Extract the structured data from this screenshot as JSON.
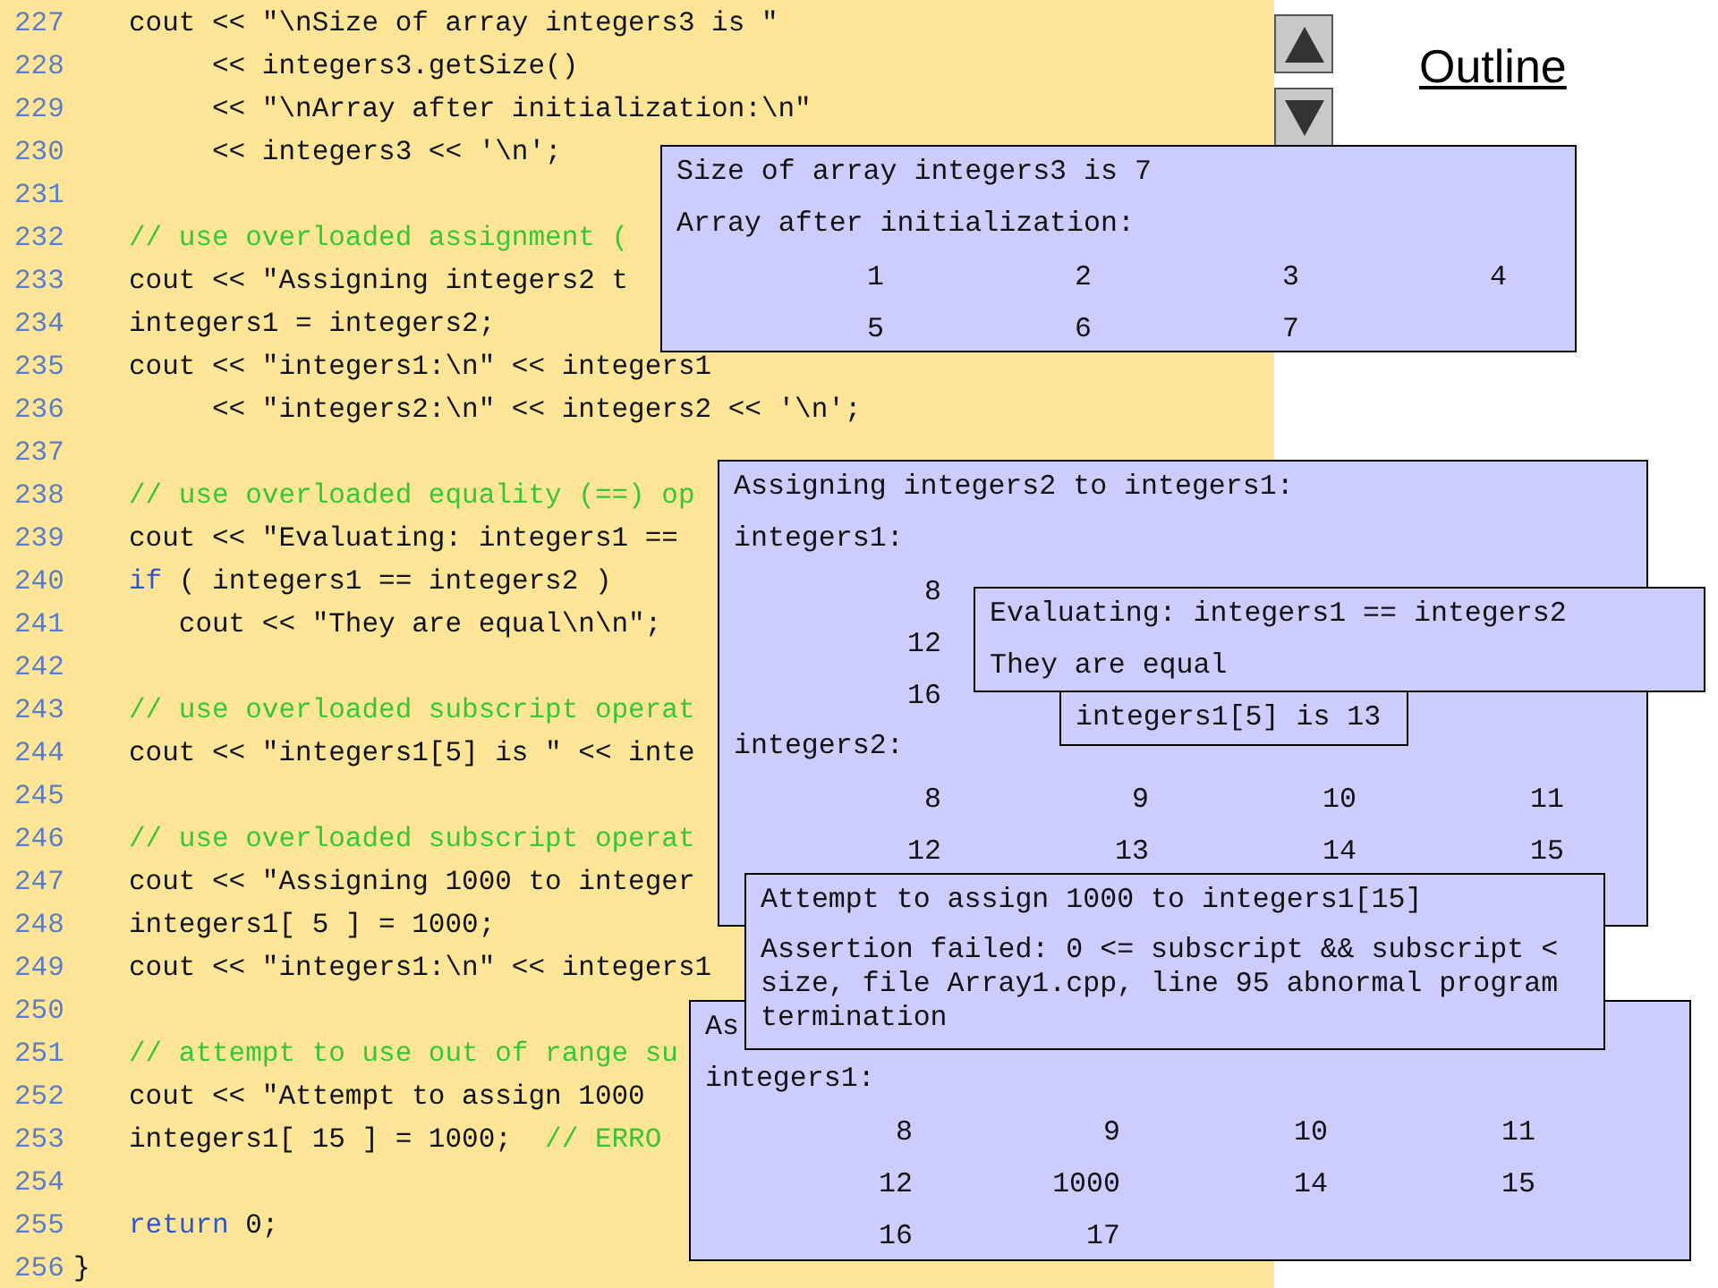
{
  "outline_title": "Outline",
  "nav_buttons": [
    {
      "kind": "up"
    },
    {
      "kind": "down"
    }
  ],
  "code_lines": [
    {
      "number": "227",
      "segments": [
        {
          "kind": "code",
          "text": "cout << \"\\nSize of array integers3 is \""
        }
      ]
    },
    {
      "number": "228",
      "segments": [
        {
          "kind": "code",
          "text": "     << integers3.getSize()"
        }
      ]
    },
    {
      "number": "229",
      "segments": [
        {
          "kind": "code",
          "text": "     << \"\\nArray after initialization:\\n\""
        }
      ]
    },
    {
      "number": "230",
      "segments": [
        {
          "kind": "code",
          "text": "     << integers3 << '\\n';"
        }
      ]
    },
    {
      "number": "231"
    },
    {
      "number": "232",
      "segments": [
        {
          "kind": "comment",
          "text": "// use overloaded assignment ("
        }
      ]
    },
    {
      "number": "233",
      "segments": [
        {
          "kind": "code",
          "text": "cout << \"Assigning integers2 t"
        }
      ]
    },
    {
      "number": "234",
      "segments": [
        {
          "kind": "code",
          "text": "integers1 = integers2;"
        }
      ]
    },
    {
      "number": "235",
      "segments": [
        {
          "kind": "code",
          "text": "cout << \"integers1:\\n\" << integers1"
        }
      ]
    },
    {
      "number": "236",
      "segments": [
        {
          "kind": "code",
          "text": "     << \"integers2:\\n\" << integers2 << '\\n';"
        }
      ]
    },
    {
      "number": "237"
    },
    {
      "number": "238",
      "segments": [
        {
          "kind": "comment",
          "text": "// use overloaded equality (==) op"
        }
      ]
    },
    {
      "number": "239",
      "segments": [
        {
          "kind": "code",
          "text": "cout << \"Evaluating: integers1 =="
        }
      ]
    },
    {
      "number": "240",
      "segments": [
        {
          "kind": "keyword",
          "text": "if"
        },
        {
          "kind": "code",
          "text": " ( integers1 == integers2 )"
        }
      ]
    },
    {
      "number": "241",
      "segments": [
        {
          "kind": "code",
          "text": "   cout << \"They are equal\\n\\n\";"
        }
      ]
    },
    {
      "number": "242"
    },
    {
      "number": "243",
      "segments": [
        {
          "kind": "comment",
          "text": "// use overloaded subscript operat"
        }
      ]
    },
    {
      "number": "244",
      "segments": [
        {
          "kind": "code",
          "text": "cout << \"integers1[5] is \" << inte"
        }
      ]
    },
    {
      "number": "245"
    },
    {
      "number": "246",
      "segments": [
        {
          "kind": "comment",
          "text": "// use overloaded subscript operat"
        }
      ]
    },
    {
      "number": "247",
      "segments": [
        {
          "kind": "code",
          "text": "cout << \"Assigning 1000 to integer"
        }
      ]
    },
    {
      "number": "248",
      "segments": [
        {
          "kind": "code",
          "text": "integers1[ 5 ] = 1000;"
        }
      ]
    },
    {
      "number": "249",
      "segments": [
        {
          "kind": "code",
          "text": "cout << \"integers1:\\n\" << integers1"
        }
      ]
    },
    {
      "number": "250"
    },
    {
      "number": "251",
      "segments": [
        {
          "kind": "comment",
          "text": "// attempt to use out of range su"
        }
      ]
    },
    {
      "number": "252",
      "segments": [
        {
          "kind": "code",
          "text": "cout << \"Attempt to assign 1000"
        }
      ]
    },
    {
      "number": "253",
      "segments": [
        {
          "kind": "code",
          "text": "integers1[ 15 ] = 1000;  "
        },
        {
          "kind": "comment",
          "text": "// ERRO"
        }
      ]
    },
    {
      "number": "254"
    },
    {
      "number": "255",
      "segments": [
        {
          "kind": "keyword",
          "text": "return"
        },
        {
          "kind": "code",
          "text": " 0;"
        }
      ]
    },
    {
      "number": "256",
      "segments": [
        {
          "kind": "brace",
          "text": "}"
        }
      ]
    }
  ],
  "output_boxes": [
    {
      "lines": [
        {
          "kind": "text",
          "text": "Size of array integers3 is 7"
        },
        {
          "kind": "text",
          "text": "Array after initialization:"
        },
        {
          "kind": "numbers",
          "values": [
            "1",
            "2",
            "3",
            "4"
          ]
        },
        {
          "kind": "numbers",
          "values": [
            "5",
            "6",
            "7"
          ]
        }
      ]
    },
    {
      "lines": [
        {
          "kind": "text",
          "text": "Assigning integers2 to integers1:"
        },
        {
          "kind": "text",
          "text": "integers1:"
        },
        {
          "kind": "numbers",
          "values": [
            "8"
          ]
        },
        {
          "kind": "numbers",
          "values": [
            "12"
          ]
        },
        {
          "kind": "numbers",
          "values": [
            "16"
          ]
        },
        {
          "kind": "text",
          "text": "integers2:"
        },
        {
          "kind": "numbers",
          "values": [
            "8",
            "9",
            "10",
            "11"
          ]
        },
        {
          "kind": "numbers",
          "values": [
            "12",
            "13",
            "14",
            "15"
          ]
        }
      ]
    },
    {
      "lines": [
        {
          "kind": "text",
          "text": "Evaluating: integers1 == integers2"
        },
        {
          "kind": "text",
          "text": "They are equal"
        }
      ]
    },
    {
      "lines": [
        {
          "kind": "text",
          "text": "integers1[5] is 13"
        }
      ]
    },
    {
      "lines": [
        {
          "kind": "text",
          "text": "As"
        },
        {
          "kind": "text",
          "text": "integers1:"
        },
        {
          "kind": "numbers",
          "values": [
            "8",
            "9",
            "10",
            "11"
          ]
        },
        {
          "kind": "numbers",
          "values": [
            "12",
            "1000",
            "14",
            "15"
          ]
        },
        {
          "kind": "numbers",
          "values": [
            "16",
            "17"
          ]
        }
      ]
    },
    {
      "lines": [
        {
          "kind": "text",
          "text": "Attempt to assign 1000 to integers1[15]"
        },
        {
          "kind": "paragraph",
          "text": "Assertion failed: 0 <= subscript && subscript < size, file Array1.cpp, line 95 abnormal program termination"
        }
      ]
    }
  ]
}
